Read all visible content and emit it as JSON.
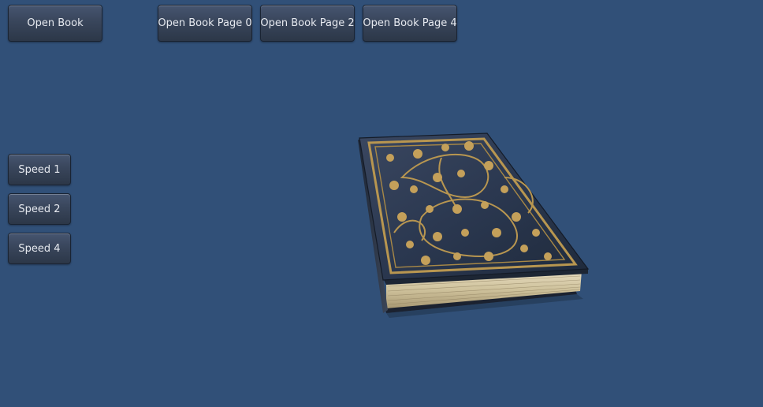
{
  "buttons": {
    "open_book": "Open Book",
    "open_page_0": "Open Book Page 0",
    "open_page_2": "Open Book Page 2",
    "open_page_4": "Open Book Page 4"
  },
  "speed_buttons": {
    "speed_1": "Speed 1",
    "speed_2": "Speed 2",
    "speed_4": "Speed 4"
  },
  "scene": {
    "background_color": "#315078",
    "book_cover_color": "#2e3b52",
    "book_ornament_color": "#b89650",
    "book_pages_color": "#d8ccaa"
  }
}
